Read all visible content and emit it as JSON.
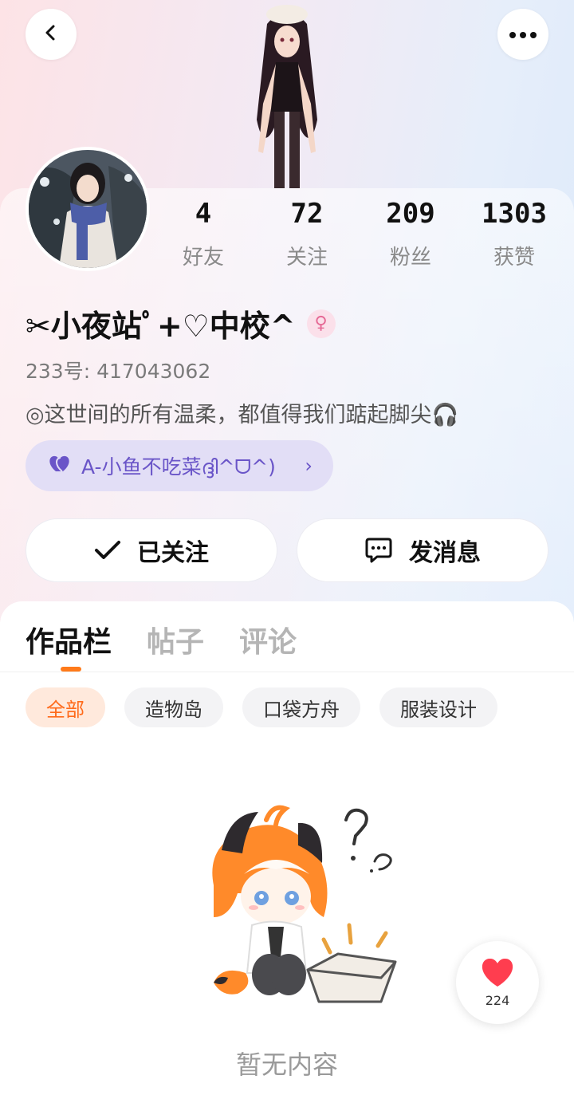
{
  "nav": {
    "back_icon": "chevron-left-icon",
    "more_icon": "more-horizontal-icon"
  },
  "profile": {
    "nickname": "✂小夜站ﾟ+♡中校^",
    "gender_symbol": "♀",
    "uid": "233号: 417043062",
    "bio": "◎这世间的所有温柔，都值得我们踮起脚尖🎧",
    "cp_badge": {
      "label": "A-小鱼不吃菜ദ്ദി^ᗜ^)",
      "arrow": "›"
    }
  },
  "stats": [
    {
      "value": "4",
      "label": "好友"
    },
    {
      "value": "72",
      "label": "关注"
    },
    {
      "value": "209",
      "label": "粉丝"
    },
    {
      "value": "1303",
      "label": "获赞"
    }
  ],
  "actions": {
    "follow_label": "已关注",
    "message_label": "发消息"
  },
  "tabs": [
    {
      "label": "作品栏",
      "active": true
    },
    {
      "label": "帖子",
      "active": false
    },
    {
      "label": "评论",
      "active": false
    }
  ],
  "chips": [
    {
      "label": "全部",
      "active": true
    },
    {
      "label": "造物岛",
      "active": false
    },
    {
      "label": "口袋方舟",
      "active": false
    },
    {
      "label": "服装设计",
      "active": false
    }
  ],
  "empty_state": {
    "text": "暂无内容"
  },
  "like_fab": {
    "count": "224"
  },
  "colors": {
    "accent": "#ff7a1a",
    "cp_purple": "#6a55c8",
    "like_red": "#ff3d4f"
  }
}
